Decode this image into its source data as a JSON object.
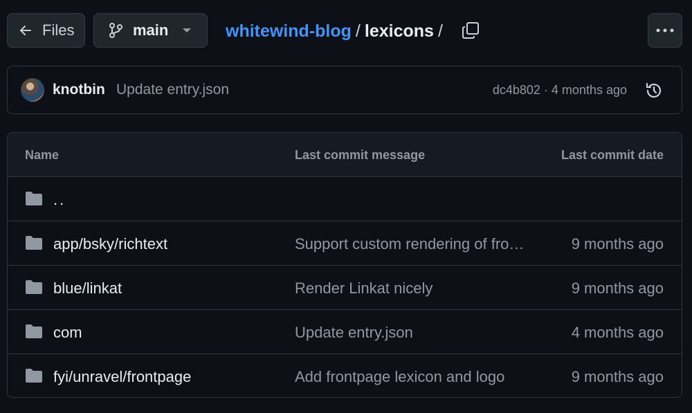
{
  "toolbar": {
    "files_label": "Files",
    "branch_label": "main",
    "more_icon": "kebab-horizontal-icon"
  },
  "breadcrumb": {
    "repo": "whitewind-blog",
    "separator": "/",
    "dir": "lexicons",
    "trailing_separator": "/"
  },
  "latest_commit": {
    "author": "knotbin",
    "message": "Update entry.json",
    "meta": "dc4b802 · 4 months ago"
  },
  "table": {
    "headers": {
      "name": "Name",
      "message": "Last commit message",
      "date": "Last commit date"
    },
    "parent_dir": "..",
    "rows": [
      {
        "name": "app/bsky/richtext",
        "message": "Support custom rendering of fro…",
        "date": "9 months ago"
      },
      {
        "name": "blue/linkat",
        "message": "Render Linkat nicely",
        "date": "9 months ago"
      },
      {
        "name": "com",
        "message": "Update entry.json",
        "date": "4 months ago"
      },
      {
        "name": "fyi/unravel/frontpage",
        "message": "Add frontpage lexicon and logo",
        "date": "9 months ago"
      }
    ]
  },
  "colors": {
    "background": "#0d1117",
    "link": "#4493f8",
    "muted": "#9198a1",
    "border": "#30363d",
    "header_bg": "#151b23"
  }
}
